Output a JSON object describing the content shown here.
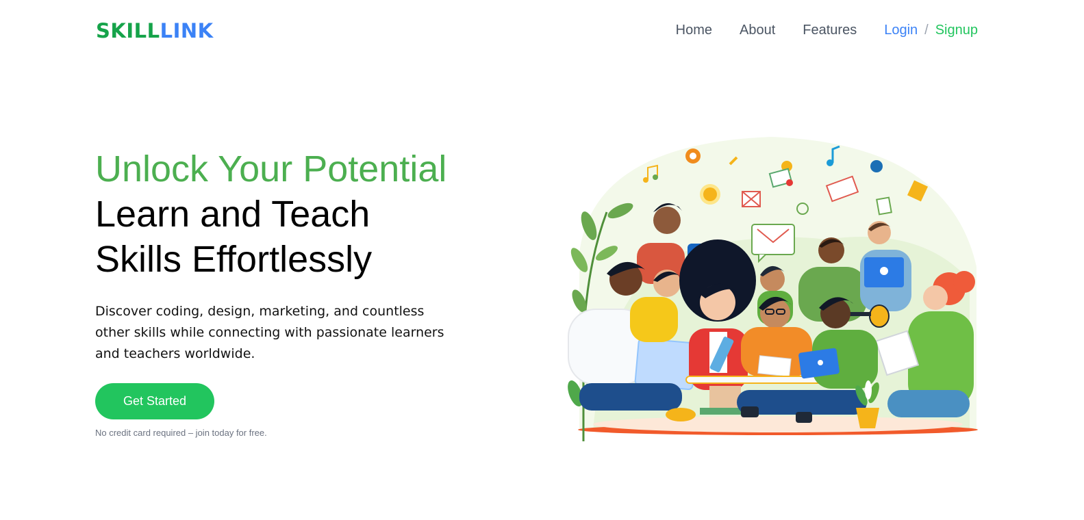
{
  "brand": {
    "part_a": "SKILL",
    "part_b": "LINK",
    "color_a": "#16a34a",
    "color_b": "#3b82f6"
  },
  "nav": {
    "home": "Home",
    "about": "About",
    "features": "Features",
    "login": "Login",
    "separator": "/",
    "signup": "Signup"
  },
  "hero": {
    "headline_accent": "Unlock Your Potential",
    "headline_line2": "Learn and Teach",
    "headline_line3": "Skills Effortlessly",
    "subtitle": "Discover coding, design, marketing, and countless other skills while connecting with passionate learners and teachers worldwide.",
    "cta_label": "Get Started",
    "note": "No credit card required – join today for free.",
    "accent_color": "#4caf50",
    "button_color": "#22c55e"
  },
  "illustration": {
    "icon": "people-learning-illustration"
  }
}
